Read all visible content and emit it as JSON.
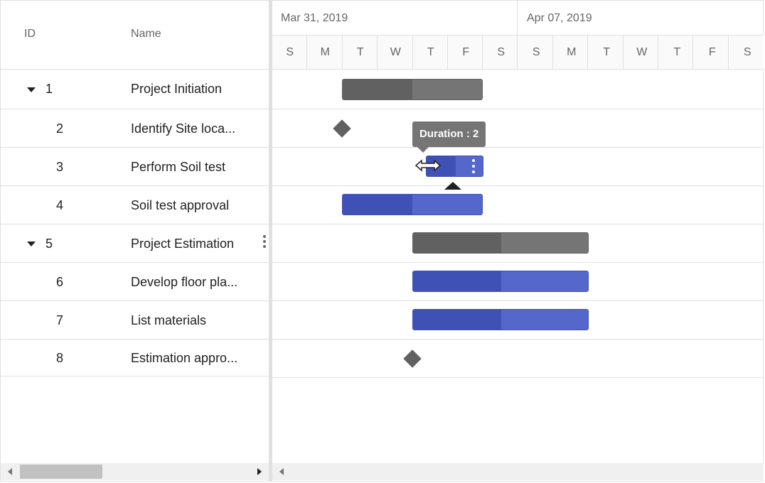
{
  "grid": {
    "columns": {
      "id": "ID",
      "name": "Name"
    },
    "rows": [
      {
        "id": "1",
        "name": "Project Initiation",
        "expandable": true
      },
      {
        "id": "2",
        "name": "Identify Site loca...",
        "expandable": false
      },
      {
        "id": "3",
        "name": "Perform Soil test",
        "expandable": false
      },
      {
        "id": "4",
        "name": "Soil test approval",
        "expandable": false
      },
      {
        "id": "5",
        "name": "Project Estimation",
        "expandable": true
      },
      {
        "id": "6",
        "name": "Develop floor pla...",
        "expandable": false
      },
      {
        "id": "7",
        "name": "List materials",
        "expandable": false
      },
      {
        "id": "8",
        "name": "Estimation appro...",
        "expandable": false
      }
    ]
  },
  "timeline": {
    "weeks": [
      "Mar 31, 2019",
      "Apr 07, 2019"
    ],
    "days": [
      "S",
      "M",
      "T",
      "W",
      "T",
      "F",
      "S",
      "S",
      "M",
      "T",
      "W",
      "T",
      "F",
      "S"
    ]
  },
  "tooltip": {
    "text": "Duration : 2"
  },
  "colors": {
    "parent_bar": "#757575",
    "parent_progress": "#616161",
    "child_bar": "#5567cb",
    "child_progress": "#3f51b5",
    "milestone": "#616161",
    "tooltip_bg": "#757575"
  },
  "icons": {
    "expand": "caret-down-icon",
    "resize_cursor": "resize-horizontal-cursor-icon",
    "column_menu": "vertical-dots-icon",
    "taskbar_menu": "vertical-dots-icon",
    "connector": "connector-triangle-icon"
  }
}
